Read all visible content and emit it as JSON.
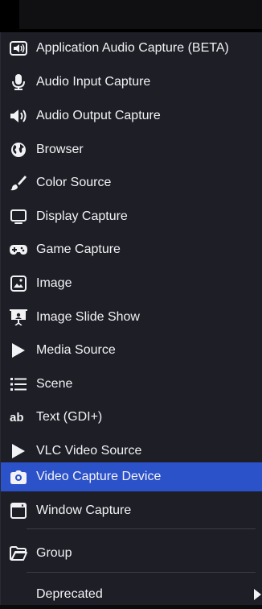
{
  "menu": {
    "items": [
      {
        "label": "Application Audio Capture (BETA)",
        "icon": "speaker-box-icon"
      },
      {
        "label": "Audio Input Capture",
        "icon": "microphone-icon"
      },
      {
        "label": "Audio Output Capture",
        "icon": "speaker-icon"
      },
      {
        "label": "Browser",
        "icon": "globe-icon"
      },
      {
        "label": "Color Source",
        "icon": "paint-brush-icon"
      },
      {
        "label": "Display Capture",
        "icon": "monitor-icon"
      },
      {
        "label": "Game Capture",
        "icon": "gamepad-icon"
      },
      {
        "label": "Image",
        "icon": "image-icon"
      },
      {
        "label": "Image Slide Show",
        "icon": "presentation-icon"
      },
      {
        "label": "Media Source",
        "icon": "play-icon"
      },
      {
        "label": "Scene",
        "icon": "list-icon"
      },
      {
        "label": "Text (GDI+)",
        "icon": "text-icon"
      },
      {
        "label": "VLC Video Source",
        "icon": "play-icon"
      },
      {
        "label": "Video Capture Device",
        "icon": "camera-icon",
        "selected": true
      },
      {
        "label": "Window Capture",
        "icon": "window-icon"
      }
    ],
    "group": {
      "label": "Group",
      "icon": "folder-icon"
    },
    "deprecated": {
      "label": "Deprecated",
      "icon": "submenu-arrow-icon"
    }
  },
  "colors": {
    "menu_bg": "#1d1e26",
    "selected_bg": "#2c52c9",
    "text": "#f2f2f5",
    "separator": "#3a3b44"
  }
}
